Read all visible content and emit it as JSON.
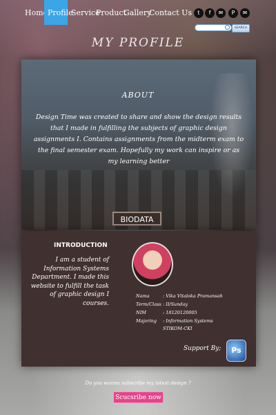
{
  "nav": {
    "items": [
      {
        "label": "Home",
        "active": false
      },
      {
        "label": "Profile",
        "active": true
      },
      {
        "label": "Service",
        "active": false
      },
      {
        "label": "Product",
        "active": false
      },
      {
        "label": "Gallery",
        "active": false
      },
      {
        "label": "Contact Us",
        "active": false
      }
    ],
    "active_color": "#3aa6e8"
  },
  "social": [
    {
      "icon": "twitter-icon",
      "glyph": "t"
    },
    {
      "icon": "facebook-icon",
      "glyph": "f"
    },
    {
      "icon": "mail-icon",
      "glyph": "✉"
    },
    {
      "icon": "pinterest-icon",
      "glyph": "P"
    },
    {
      "icon": "email-icon",
      "glyph": "✉"
    }
  ],
  "search": {
    "button_label": "SEARCH",
    "value": ""
  },
  "page_title": "MY PROFILE",
  "about": {
    "title": "ABOUT",
    "text": "Design Time was created to share and show the design results that I made in fulfilling the subjects of graphic design assignments I. Contains assignments from the midterm exam to the final semester exam. Hopefully my work can inspire or as my learning better"
  },
  "biodata_button": "BIODATA",
  "introduction": {
    "title": "INTRODUCTION",
    "text": "I am a student of Information Systems Department. I made this website to fulfill the task of graphic design I courses."
  },
  "profile": {
    "name_label": "Nama",
    "name_value": ": Vika Vitaloka Pramansah",
    "term_label": "Term/Class",
    "term_value": ": II/Sunday",
    "nim_label": "NIM",
    "nim_value": ": 18120120005",
    "major_label": "Majoring",
    "major_value": ": Information Systems",
    "school": "STIKOM-CKI"
  },
  "support": {
    "label": "Support By;",
    "logo_text": "Ps"
  },
  "subscribe": {
    "question": "Do you wanna subscribe my latest design ?",
    "button_label": "Scucsribe now"
  }
}
